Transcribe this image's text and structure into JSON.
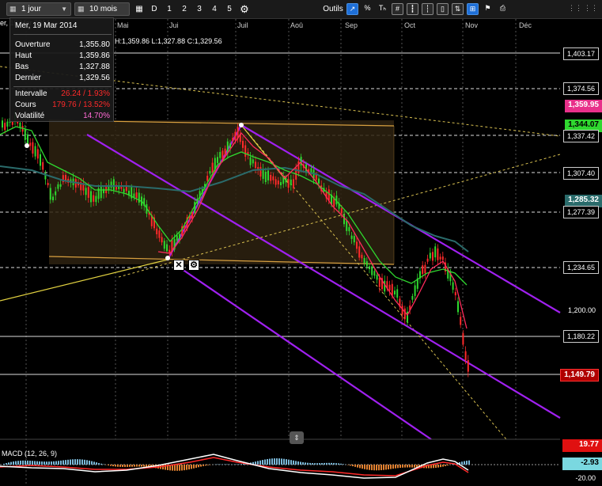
{
  "toolbar": {
    "interval": {
      "prefix_icon": "calendar-small-icon",
      "value": "1 jour"
    },
    "range": {
      "prefix_icon": "calendar-small-icon",
      "value": "10 mois"
    },
    "periods": [
      "D",
      "1",
      "2",
      "3",
      "4",
      "5"
    ],
    "settings_icon": "gear-icon",
    "tools_label": "Outils",
    "tools": [
      {
        "name": "trendline-tool-icon",
        "glyph": "↗"
      },
      {
        "name": "percent-tool-icon",
        "glyph": "%"
      },
      {
        "name": "text-tool-icon",
        "glyph": "Tₕ"
      },
      {
        "name": "grid-tool-icon",
        "glyph": "#"
      },
      {
        "name": "candles-tool-icon",
        "glyph": "┇"
      },
      {
        "name": "bars-tool-icon",
        "glyph": "┆"
      },
      {
        "name": "hollow-candles-tool-icon",
        "glyph": "▯"
      },
      {
        "name": "indicator-tool-icon",
        "glyph": "⇅"
      },
      {
        "name": "compare-tool-icon",
        "glyph": "⊞"
      },
      {
        "name": "flag-tool-icon",
        "glyph": "⚑"
      },
      {
        "name": "print-icon",
        "glyph": "⎙"
      },
      {
        "name": "tools-settings-icon",
        "glyph": "✎"
      }
    ],
    "window_icons": [
      {
        "name": "menu-grid-icon",
        "glyph": "⋮⋮"
      },
      {
        "name": "window-grid-icon",
        "glyph": "⋮⋮"
      }
    ]
  },
  "months": [
    "Mai",
    "Jui",
    "Juil",
    "Aoû",
    "Sep",
    "Oct",
    "Nov",
    "Déc"
  ],
  "tooltip": {
    "date": "Mer, 19 Mar 2014",
    "rows": [
      {
        "key": "Ouverture",
        "value": "1,355.80",
        "color": "white"
      },
      {
        "key": "Haut",
        "value": "1,359.86",
        "color": "white"
      },
      {
        "key": "Bas",
        "value": "1,327.88",
        "color": "white"
      },
      {
        "key": "Dernier",
        "value": "1,329.56",
        "color": "white"
      },
      {
        "key": "Intervalle",
        "value": "26.24 / 1.93%",
        "color": "red"
      },
      {
        "key": "Cours",
        "value": "179.76 / 13.52%",
        "color": "red"
      },
      {
        "key": "Volatilité",
        "value": "14.70%",
        "color": "pink"
      }
    ]
  },
  "header_fragments": {
    "top_left": "er, 19 Mar 2014",
    "ohlc": "H:1,359.86  L:1,327.88  C:1,329.56"
  },
  "price_axis": {
    "levels": [
      {
        "label": "1,403.17",
        "style": "boxed"
      },
      {
        "label": "1,374.56",
        "style": "boxed"
      },
      {
        "label": "1,359.95",
        "style": "magenta"
      },
      {
        "label": "1,344.07",
        "style": "green"
      },
      {
        "label": "1,337.42",
        "style": "boxed"
      },
      {
        "label": "1,307.40",
        "style": "boxed"
      },
      {
        "label": "1,285.32",
        "style": "teal"
      },
      {
        "label": "1,277.39",
        "style": "boxed"
      },
      {
        "label": "1,234.65",
        "style": "boxed"
      },
      {
        "label": "1,200.00",
        "style": "plain"
      },
      {
        "label": "1,180.22",
        "style": "boxed"
      },
      {
        "label": "1,149.79",
        "style": "red"
      }
    ],
    "macd_levels": [
      {
        "label": "19.77",
        "style": "red"
      },
      {
        "label": "-2.93",
        "style": "teal"
      },
      {
        "label": "-20.00",
        "style": "plain"
      }
    ]
  },
  "macd": {
    "label": "MACD (12, 26, 9)"
  },
  "handles": {
    "close_icon": "close-icon",
    "settings_icon": "gear-icon"
  },
  "collapse_icon": "chevron-updown-icon",
  "colors": {
    "background": "#000000",
    "channel": "#a020f0",
    "fib_box": "#3a2a10",
    "fib_border": "#d8a040",
    "ma_green": "#2fd82f",
    "ma_red": "#ff2a5a",
    "ma_teal": "#2a6b6b",
    "candle_up": "#2fd82f",
    "candle_down": "#ff2a2a"
  }
}
